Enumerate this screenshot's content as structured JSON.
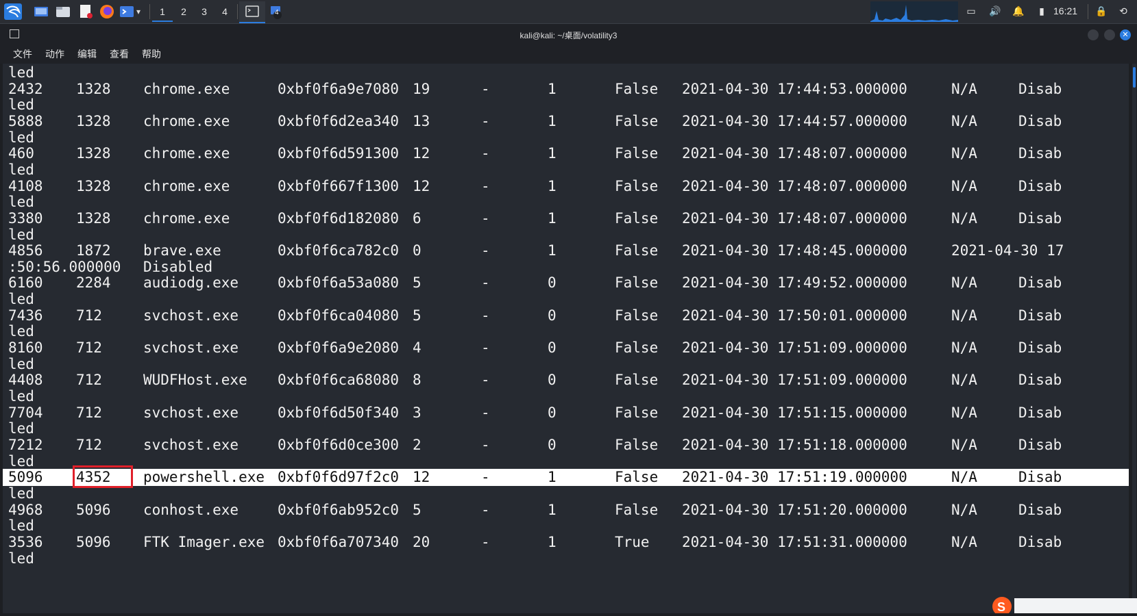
{
  "taskbar": {
    "workspaces": [
      "1",
      "2",
      "3",
      "4"
    ],
    "active_workspace": "1",
    "terminal_badge": "4",
    "clock": "16:21",
    "accent_color": "#2b7de0"
  },
  "window": {
    "title": "kali@kali: ~/桌面/volatility3"
  },
  "menu": [
    "文件",
    "动作",
    "编辑",
    "查看",
    "帮助"
  ],
  "terminal": {
    "rows": [
      {
        "cells": [
          "led"
        ]
      },
      {
        "cells": [
          "2432",
          "1328",
          "chrome.exe",
          "0xbf0f6a9e7080",
          "19",
          "-",
          "1",
          "False",
          "2021-04-30 17:44:53.000000",
          "N/A",
          "Disab"
        ]
      },
      {
        "cells": [
          "led"
        ]
      },
      {
        "cells": [
          "5888",
          "1328",
          "chrome.exe",
          "0xbf0f6d2ea340",
          "13",
          "-",
          "1",
          "False",
          "2021-04-30 17:44:57.000000",
          "N/A",
          "Disab"
        ]
      },
      {
        "cells": [
          "led"
        ]
      },
      {
        "cells": [
          "460",
          "1328",
          "chrome.exe",
          "0xbf0f6d591300",
          "12",
          "-",
          "1",
          "False",
          "2021-04-30 17:48:07.000000",
          "N/A",
          "Disab"
        ]
      },
      {
        "cells": [
          "led"
        ]
      },
      {
        "cells": [
          "4108",
          "1328",
          "chrome.exe",
          "0xbf0f667f1300",
          "12",
          "-",
          "1",
          "False",
          "2021-04-30 17:48:07.000000",
          "N/A",
          "Disab"
        ]
      },
      {
        "cells": [
          "led"
        ]
      },
      {
        "cells": [
          "3380",
          "1328",
          "chrome.exe",
          "0xbf0f6d182080",
          "6",
          "-",
          "1",
          "False",
          "2021-04-30 17:48:07.000000",
          "N/A",
          "Disab"
        ]
      },
      {
        "cells": [
          "led"
        ]
      },
      {
        "cells": [
          "4856",
          "1872",
          "brave.exe",
          "0xbf0f6ca782c0",
          "0",
          "-",
          "1",
          "False",
          "2021-04-30 17:48:45.000000",
          "2021-04-30 17"
        ]
      },
      {
        "cells": [
          ":50:56.000000",
          "Disabled"
        ]
      },
      {
        "cells": [
          "6160",
          "2284",
          "audiodg.exe",
          "0xbf0f6a53a080",
          "5",
          "-",
          "0",
          "False",
          "2021-04-30 17:49:52.000000",
          "N/A",
          "Disab"
        ]
      },
      {
        "cells": [
          "led"
        ]
      },
      {
        "cells": [
          "7436",
          "712",
          "svchost.exe",
          "0xbf0f6ca04080",
          "5",
          "-",
          "0",
          "False",
          "2021-04-30 17:50:01.000000",
          "N/A",
          "Disab"
        ]
      },
      {
        "cells": [
          "led"
        ]
      },
      {
        "cells": [
          "8160",
          "712",
          "svchost.exe",
          "0xbf0f6a9e2080",
          "4",
          "-",
          "0",
          "False",
          "2021-04-30 17:51:09.000000",
          "N/A",
          "Disab"
        ]
      },
      {
        "cells": [
          "led"
        ]
      },
      {
        "cells": [
          "4408",
          "712",
          "WUDFHost.exe",
          "0xbf0f6ca68080",
          "8",
          "-",
          "0",
          "False",
          "2021-04-30 17:51:09.000000",
          "N/A",
          "Disab"
        ]
      },
      {
        "cells": [
          "led"
        ]
      },
      {
        "cells": [
          "7704",
          "712",
          "svchost.exe",
          "0xbf0f6d50f340",
          "3",
          "-",
          "0",
          "False",
          "2021-04-30 17:51:15.000000",
          "N/A",
          "Disab"
        ]
      },
      {
        "cells": [
          "led"
        ]
      },
      {
        "cells": [
          "7212",
          "712",
          "svchost.exe",
          "0xbf0f6d0ce300",
          "2",
          "-",
          "0",
          "False",
          "2021-04-30 17:51:18.000000",
          "N/A",
          "Disab"
        ]
      },
      {
        "cells": [
          "led"
        ]
      },
      {
        "cells": [
          "5096",
          "4352",
          "powershell.exe",
          "0xbf0f6d97f2c0",
          "12",
          "-",
          "1",
          "False",
          "2021-04-30 17:51:19.000000",
          "N/A",
          "Disab"
        ],
        "highlighted": true
      },
      {
        "cells": [
          "led"
        ]
      },
      {
        "cells": [
          "4968",
          "5096",
          "conhost.exe",
          "0xbf0f6ab952c0",
          "5",
          "-",
          "1",
          "False",
          "2021-04-30 17:51:20.000000",
          "N/A",
          "Disab"
        ]
      },
      {
        "cells": [
          "led"
        ]
      },
      {
        "cells": [
          "3536",
          "5096",
          "FTK Imager.exe",
          "0xbf0f6a707340",
          "20",
          "-",
          "1",
          "True",
          "2021-04-30 17:51:31.000000",
          "N/A",
          "Disab"
        ]
      },
      {
        "cells": [
          "led"
        ]
      }
    ],
    "highlight_color": "#ffffff",
    "annotation_color": "#e0202a"
  }
}
